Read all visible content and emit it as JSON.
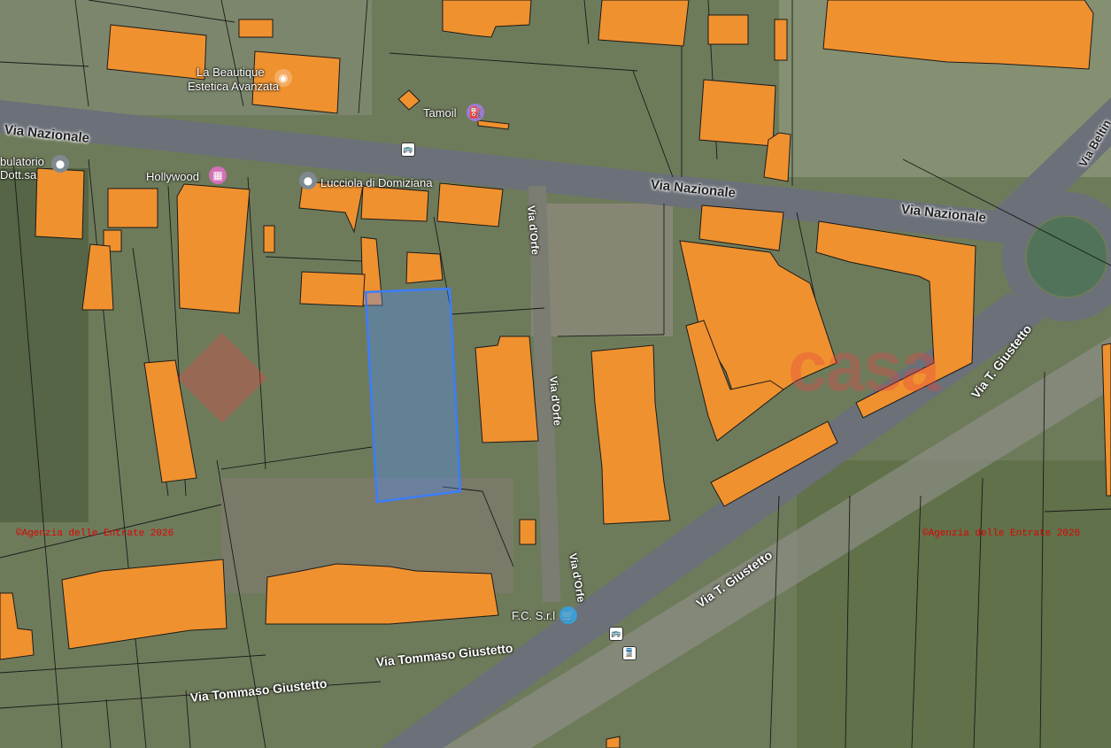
{
  "roads": {
    "via_nazionale_left": "Via Nazionale",
    "via_nazionale_mid": "Via Nazionale",
    "via_nazionale_right": "Via Nazionale",
    "via_dorfo_1": "Via d'Orfe",
    "via_dorfo_2": "Via d'Orfe",
    "via_dorfo_3": "Via d'Orfe",
    "via_t_giustetto_1": "Via T. Giustetto",
    "via_t_giustetto_2": "Via T. Giustetto",
    "via_tommaso_giustetto_1": "Via Tommaso Giustetto",
    "via_tommaso_giustetto_2": "Via Tommaso Giustetto",
    "via_beltin": "Via Beltin"
  },
  "pois": {
    "beautique": "La Beautique",
    "estetica": "Estetica Avanzata",
    "tamoil": "Tamoil",
    "hollywood": "Hollywood",
    "lucciola": "Lucciola di Domiziana",
    "ambulatorio": "bulatorio",
    "dott": "Dott.sa",
    "fc_srl": "F.C. S.r.l"
  },
  "watermark": "casa",
  "copyright_left": "©Agenzia delle Entrate 2026",
  "copyright_right": "©Agenzia delle Entrate 2026",
  "colors": {
    "building": "#f0912f",
    "parcel_highlight": "#3a7dff",
    "road": "#6d7280",
    "copyright": "#e00000"
  }
}
